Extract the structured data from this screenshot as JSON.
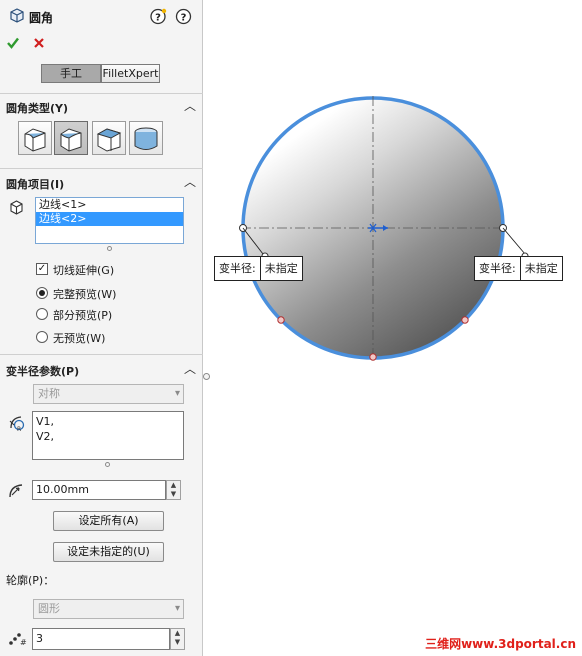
{
  "panel": {
    "title": "圆角",
    "help_icon": "help-icon",
    "pin_icon": "pushpin-icon",
    "ok_icon": "checkmark-icon",
    "cancel_icon": "cancel-icon",
    "mode_tabs": [
      "手工",
      "FilletXpert"
    ],
    "fillet_type": {
      "title": "圆角类型(Y)",
      "buttons": [
        "constant-size-fillet",
        "variable-size-fillet",
        "face-fillet",
        "full-round-fillet"
      ]
    },
    "items": {
      "title": "圆角项目(I)",
      "list": [
        "边线<1>",
        "边线<2>"
      ],
      "tangent_propagation": "切线延伸(G)",
      "preview_options": [
        "完整预览(W)",
        "部分预览(P)",
        "无预览(W)"
      ]
    },
    "variable_params": {
      "title": "变半径参数(P)",
      "symmetry": "对称",
      "vertices": [
        "V1,",
        "V2,"
      ],
      "radius": "10.00mm",
      "set_all": "设定所有(A)",
      "set_unassigned": "设定未指定的(U)",
      "profile_label": "轮廓(P)：",
      "profile": "圆形",
      "instances": "3"
    }
  },
  "graphics": {
    "callout_label": "变半径:",
    "callout_value": "未指定",
    "accent": "#4a8fdc"
  },
  "watermark": "三维网www.3dportal.cn"
}
